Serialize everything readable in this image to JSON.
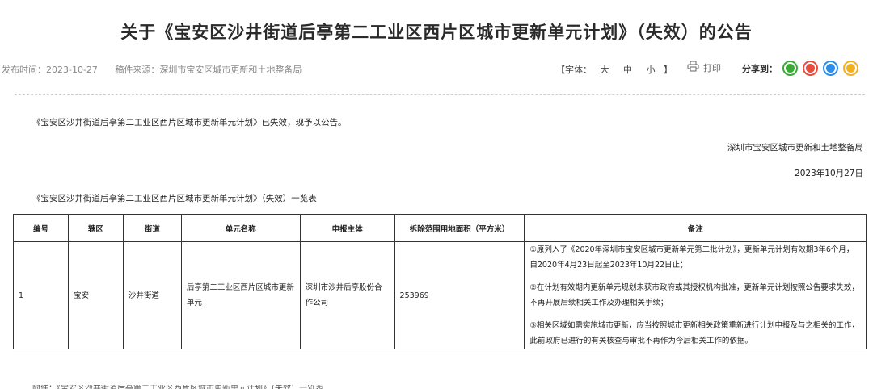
{
  "title": "关于《宝安区沙井街道后亭第二工业区西片区城市更新单元计划》（失效）的公告",
  "meta": {
    "publish_time": "发布时间：2023-10-27",
    "source": "稿件来源：深圳市宝安区城市更新和土地整备局"
  },
  "font_control": {
    "prefix": "【字体：",
    "large": "大",
    "medium": "中",
    "small": "小",
    "suffix": "】"
  },
  "print_label": "打印",
  "share": {
    "label": "分享到：",
    "buttons": [
      {
        "name": "wechat",
        "color": "#3aa935"
      },
      {
        "name": "weibo",
        "color": "#e94b3c"
      },
      {
        "name": "qq",
        "color": "#2e8de5"
      },
      {
        "name": "qzone",
        "color": "#f2b01e"
      }
    ]
  },
  "notice": "《宝安区沙井街道后亭第二工业区西片区城市更新单元计划》已失效，现予以公告。",
  "issuer": "深圳市宝安区城市更新和土地整备局",
  "date": "2023年10月27日",
  "table_caption": "《宝安区沙井街道后亭第二工业区西片区城市更新单元计划》（失效）一览表",
  "table": {
    "headers": [
      "编号",
      "辖区",
      "街道",
      "单元名称",
      "申报主体",
      "拆除范围用地面积（平方米）",
      "备注"
    ],
    "row": {
      "no": "1",
      "district": "宝安",
      "street": "沙井街道",
      "unit_name": "后亭第二工业区西片区城市更新单元",
      "applicant": "深圳市沙井后亭股份合作公司",
      "area": "253969",
      "remarks": [
        "①原列入了《2020年深圳市宝安区城市更新单元第二批计划》，更新单元计划有效期3年6个月，自2020年4月23日起至2023年10月22日止；",
        "②在计划有效期内更新单元规划未获市政府或其授权机构批准，更新单元计划按照公告要求失效，不再开展后续相关工作及办理相关手续；",
        "③相关区域如需实施城市更新，应当按照城市更新相关政策重新进行计划申报及与之相关的工作，此前政府已进行的有关核查与审批不再作为今后相关工作的依据。"
      ]
    }
  },
  "cut_line": "附件：《宝安区沙井街道后亭第二工业区西片区城市更新单元计划》（失效）一览表"
}
